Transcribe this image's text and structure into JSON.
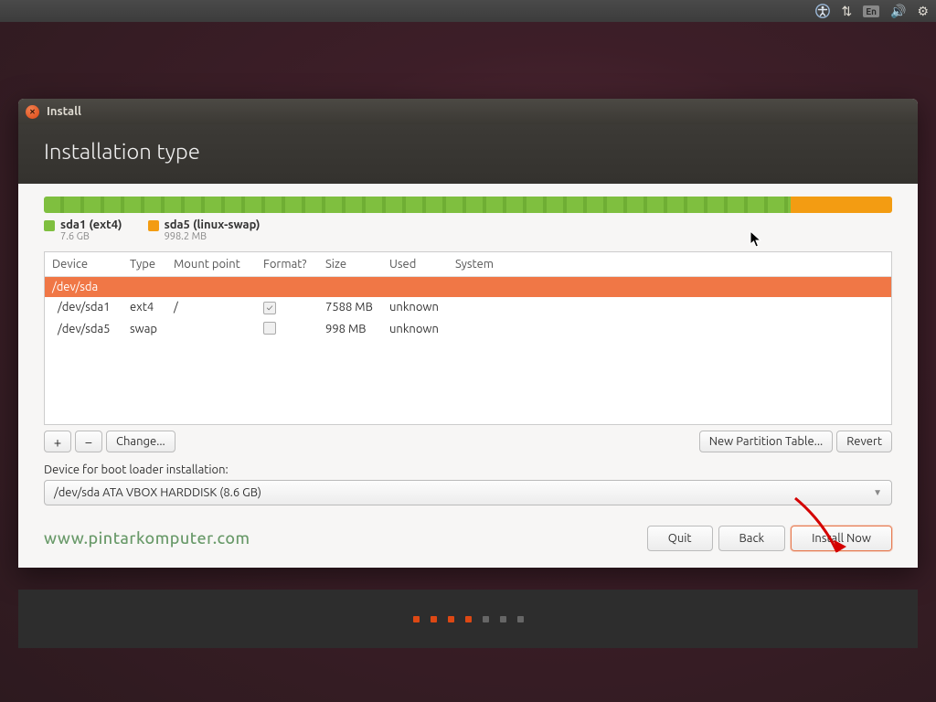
{
  "menubar": {
    "lang": "En"
  },
  "window": {
    "title": "Install",
    "heading": "Installation type"
  },
  "partitions": [
    {
      "name": "sda1 (ext4)",
      "size": "7.6 GB",
      "color": "green",
      "pct": 88
    },
    {
      "name": "sda5 (linux-swap)",
      "size": "998.2 MB",
      "color": "orange",
      "pct": 12
    }
  ],
  "table": {
    "headers": [
      "Device",
      "Type",
      "Mount point",
      "Format?",
      "Size",
      "Used",
      "System"
    ],
    "rows": [
      {
        "device": "/dev/sda",
        "type": "",
        "mount": "",
        "format": null,
        "size": "",
        "used": "",
        "system": "",
        "selected": true
      },
      {
        "device": "/dev/sda1",
        "type": "ext4",
        "mount": "/",
        "format": true,
        "size": "7588 MB",
        "used": "unknown",
        "system": ""
      },
      {
        "device": "/dev/sda5",
        "type": "swap",
        "mount": "",
        "format": false,
        "size": "998 MB",
        "used": "unknown",
        "system": ""
      }
    ]
  },
  "toolbar": {
    "add": "+",
    "remove": "−",
    "change": "Change...",
    "new_table": "New Partition Table...",
    "revert": "Revert"
  },
  "bootloader": {
    "label": "Device for boot loader installation:",
    "value": "/dev/sda   ATA VBOX HARDDISK (8.6 GB)"
  },
  "footer": {
    "watermark": "www.pintarkomputer.com",
    "quit": "Quit",
    "back": "Back",
    "install": "Install Now"
  },
  "pager": {
    "total": 7,
    "active": 3
  }
}
